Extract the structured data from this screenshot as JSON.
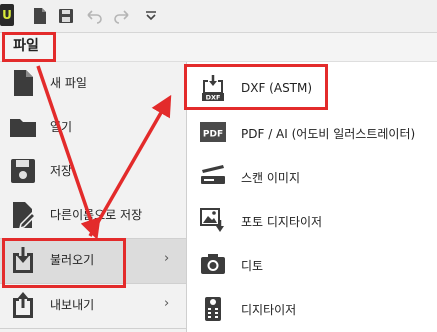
{
  "toolbar": {
    "logo_letter": "U",
    "icons": [
      "new-file-icon",
      "save-icon",
      "undo-icon",
      "redo-icon",
      "customize-toolbar-icon"
    ]
  },
  "menubar": {
    "file_label": "파일"
  },
  "file_menu": {
    "items": [
      {
        "label": "새 파일",
        "icon": "new-file-icon"
      },
      {
        "label": "열기",
        "icon": "folder-open-icon"
      },
      {
        "label": "저장",
        "icon": "save-icon"
      },
      {
        "label": "다른이름으로 저장",
        "icon": "save-as-icon"
      },
      {
        "label": "불러오기",
        "icon": "import-icon",
        "submenu_indicator": "›"
      },
      {
        "label": "내보내기",
        "icon": "export-icon",
        "submenu_indicator": "›"
      }
    ]
  },
  "import_submenu": {
    "items": [
      {
        "label": "DXF (ASTM)",
        "icon": "dxf-file-icon",
        "icon_text": "DXF"
      },
      {
        "label": "PDF / AI (어도비 일러스트레이터)",
        "icon": "pdf-file-icon",
        "icon_text": "PDF"
      },
      {
        "label": "스캔 이미지",
        "icon": "scanner-icon"
      },
      {
        "label": "포토 디지타이저",
        "icon": "photo-digitizer-icon"
      },
      {
        "label": "디토",
        "icon": "camera-icon"
      },
      {
        "label": "디지타이저",
        "icon": "digitizer-tablet-icon"
      }
    ]
  },
  "annotation_color": "#e32b2b"
}
